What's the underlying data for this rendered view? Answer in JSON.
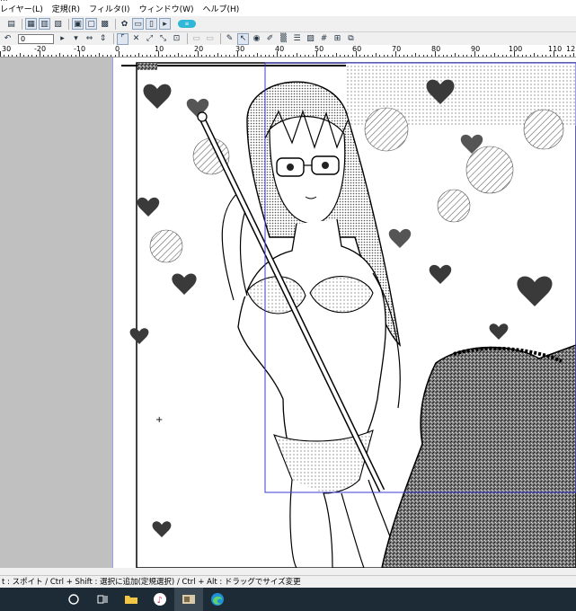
{
  "title_fragment": "...",
  "menu": [
    "レイヤー(L)",
    "定規(R)",
    "フィルタ(I)",
    "ウィンドウ(W)",
    "ヘルプ(H)"
  ],
  "toolbar": {
    "angle_value": "0"
  },
  "ruler": {
    "labels": [
      "30",
      "-20",
      "-10",
      "0",
      "10",
      "20",
      "30",
      "40",
      "50",
      "60",
      "70",
      "80",
      "90",
      "100",
      "110",
      "12"
    ]
  },
  "status": {
    "hint": "t : スポイト / Ctrl + Shift : 選択に追加(定規選択) / Ctrl + Alt : ドラッグでサイズ変更"
  },
  "taskbar": {
    "items": [
      "search-icon",
      "task-view-icon",
      "file-explorer-icon",
      "itunes-icon",
      "image-app-icon",
      "edge-browser-icon"
    ]
  },
  "colors": {
    "workspace": "#c0c0c0",
    "guide": "#3b3bd6",
    "taskbar": "#1c2b36"
  }
}
